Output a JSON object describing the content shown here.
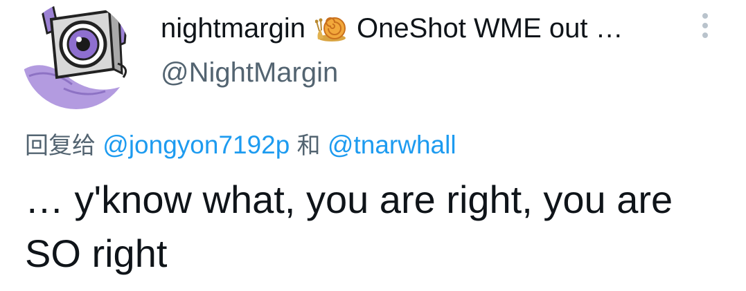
{
  "tweet": {
    "author": {
      "display_name": "nightmargin",
      "name_emoji": "snail-emoji",
      "name_suffix": "OneShot WME out …",
      "handle": "@NightMargin",
      "avatar_icon": "purple-robot-eye-avatar"
    },
    "more_icon": "vertical-ellipsis-icon",
    "reply": {
      "prefix": "回复给",
      "mention_1": "@jongyon7192p",
      "conjunction": "和",
      "mention_2": "@tnarwhall"
    },
    "text": "… y'know what, you are right, you are SO right"
  },
  "colors": {
    "text_primary": "#0f1419",
    "text_secondary": "#536471",
    "link": "#1d9bf0",
    "avatar_purple": "#a58bd6"
  }
}
